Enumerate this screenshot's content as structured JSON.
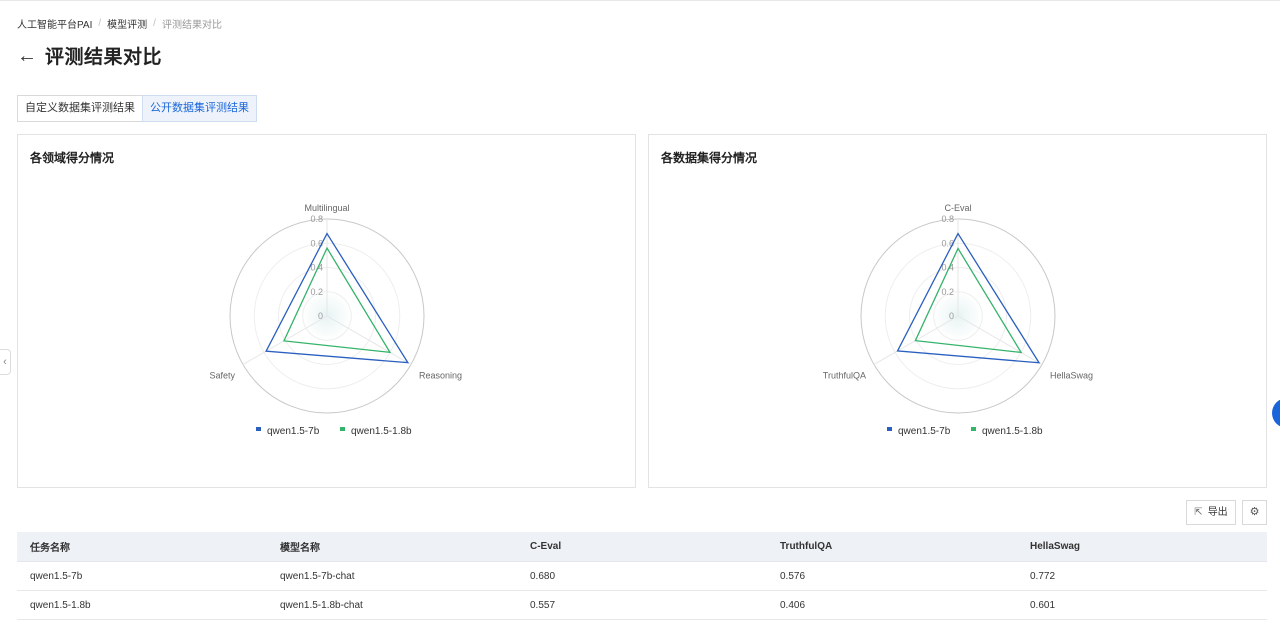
{
  "breadcrumb": [
    "人工智能平台PAI",
    "模型评测",
    "评测结果对比"
  ],
  "page": {
    "title": "评测结果对比"
  },
  "tabs": [
    {
      "label": "自定义数据集评测结果",
      "active": false
    },
    {
      "label": "公开数据集评测结果",
      "active": true
    }
  ],
  "colors": {
    "series1": "#2a5fbf",
    "series2": "#34b36b",
    "accent": "#1a66d9"
  },
  "chart_data": [
    {
      "type": "radar",
      "title": "各领域得分情况",
      "axes": [
        "Multilingual",
        "Reasoning",
        "Safety"
      ],
      "rlim": [
        0,
        0.8
      ],
      "ticks": [
        0,
        0.2,
        0.4,
        0.6,
        0.8
      ],
      "legend": "bottom",
      "series": [
        {
          "name": "qwen1.5-7b",
          "values": [
            0.68,
            0.77,
            0.58
          ]
        },
        {
          "name": "qwen1.5-1.8b",
          "values": [
            0.56,
            0.6,
            0.41
          ]
        }
      ]
    },
    {
      "type": "radar",
      "title": "各数据集得分情况",
      "axes": [
        "C-Eval",
        "HellaSwag",
        "TruthfulQA"
      ],
      "rlim": [
        0,
        0.8
      ],
      "ticks": [
        0,
        0.2,
        0.4,
        0.6,
        0.8
      ],
      "legend": "bottom",
      "series": [
        {
          "name": "qwen1.5-7b",
          "values": [
            0.68,
            0.772,
            0.576
          ]
        },
        {
          "name": "qwen1.5-1.8b",
          "values": [
            0.557,
            0.601,
            0.406
          ]
        }
      ]
    }
  ],
  "toolbar": {
    "export_label": "导出"
  },
  "table": {
    "headers": [
      "任务名称",
      "模型名称",
      "C-Eval",
      "TruthfulQA",
      "HellaSwag"
    ],
    "rows": [
      [
        "qwen1.5-7b",
        "qwen1.5-7b-chat",
        "0.680",
        "0.576",
        "0.772"
      ],
      [
        "qwen1.5-1.8b",
        "qwen1.5-1.8b-chat",
        "0.557",
        "0.406",
        "0.601"
      ]
    ]
  }
}
